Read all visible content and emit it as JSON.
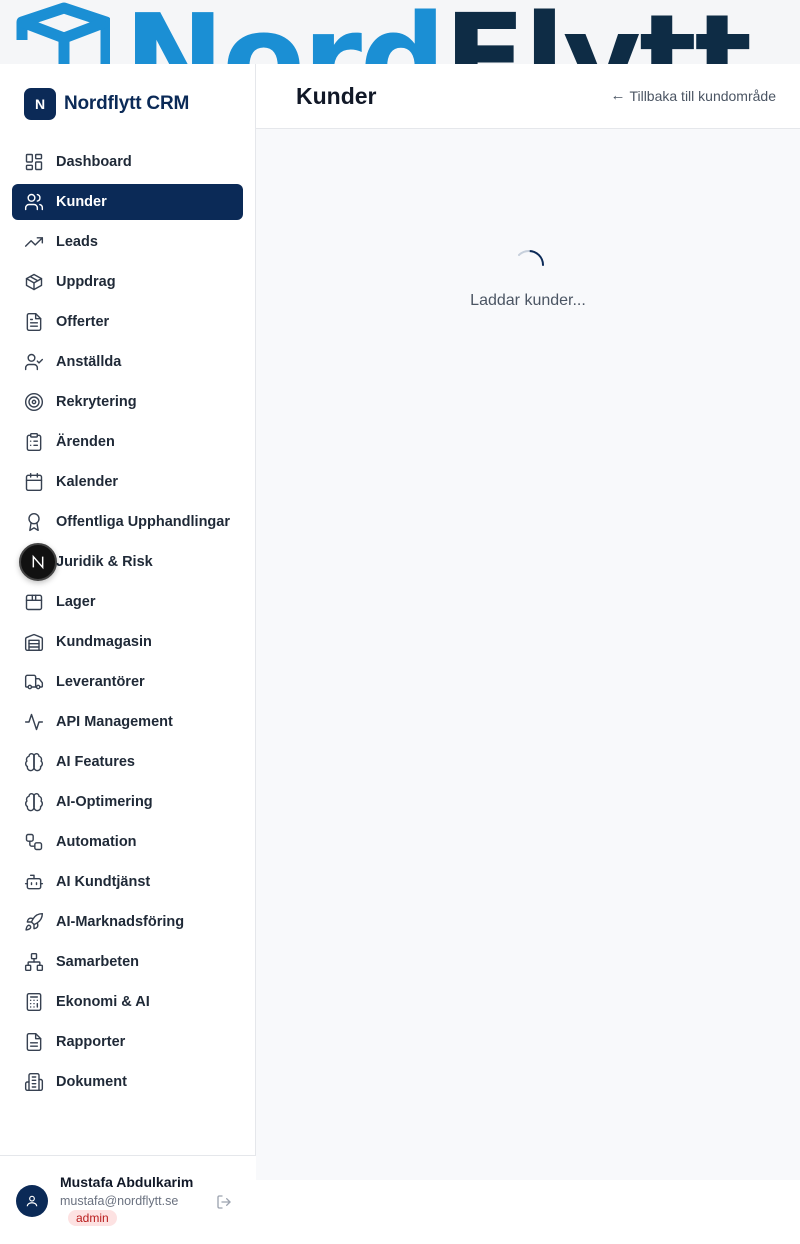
{
  "brand": {
    "badge": "N",
    "name": "Nordflytt CRM"
  },
  "banner": {
    "word_a": "Nord",
    "word_b": "Flytt"
  },
  "nav": {
    "items": [
      {
        "label": "Dashboard",
        "icon": "dashboard-icon"
      },
      {
        "label": "Kunder",
        "icon": "users-icon",
        "active": true
      },
      {
        "label": "Leads",
        "icon": "trending-up-icon"
      },
      {
        "label": "Uppdrag",
        "icon": "package-icon"
      },
      {
        "label": "Offerter",
        "icon": "file-text-icon"
      },
      {
        "label": "Anställda",
        "icon": "user-check-icon"
      },
      {
        "label": "Rekrytering",
        "icon": "target-icon"
      },
      {
        "label": "Ärenden",
        "icon": "clipboard-icon"
      },
      {
        "label": "Kalender",
        "icon": "calendar-icon"
      },
      {
        "label": "Offentliga Upphandlingar",
        "icon": "award-icon"
      },
      {
        "label": "Juridik & Risk",
        "icon": "scale-icon"
      },
      {
        "label": "Lager",
        "icon": "box-icon"
      },
      {
        "label": "Kundmagasin",
        "icon": "warehouse-icon"
      },
      {
        "label": "Leverantörer",
        "icon": "truck-icon"
      },
      {
        "label": "API Management",
        "icon": "activity-icon"
      },
      {
        "label": "AI Features",
        "icon": "brain-icon"
      },
      {
        "label": "AI-Optimering",
        "icon": "brain-icon"
      },
      {
        "label": "Automation",
        "icon": "workflow-icon"
      },
      {
        "label": "AI Kundtjänst",
        "icon": "bot-icon"
      },
      {
        "label": "AI-Marknadsföring",
        "icon": "rocket-icon"
      },
      {
        "label": "Samarbeten",
        "icon": "network-icon"
      },
      {
        "label": "Ekonomi & AI",
        "icon": "calculator-icon"
      },
      {
        "label": "Rapporter",
        "icon": "report-icon"
      },
      {
        "label": "Dokument",
        "icon": "building-icon"
      }
    ]
  },
  "dev_badge": "N",
  "user": {
    "name": "Mustafa Abdulkarim",
    "email": "mustafa@nordflytt.se",
    "role": "admin"
  },
  "header": {
    "title": "Kunder",
    "back_arrow": "←",
    "back_label": "Tillbaka till kundområde"
  },
  "loading": {
    "text": "Laddar kunder..."
  },
  "colors": {
    "accent": "#0b2a57",
    "banner_blue": "#1b8fd4",
    "banner_dark": "#0e2c45",
    "role_bg": "#fde2e2",
    "role_text": "#b91c1c"
  }
}
